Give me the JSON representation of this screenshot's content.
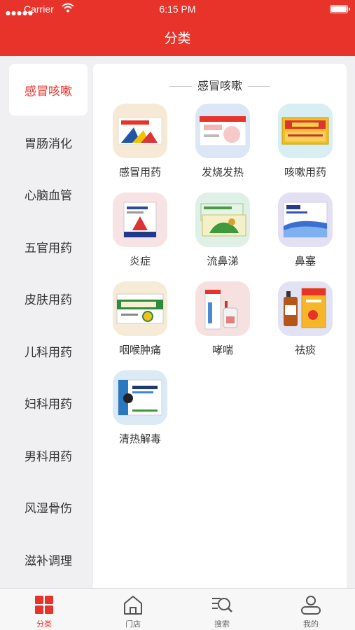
{
  "status_bar": {
    "carrier": "Carrier",
    "time": "6:15 PM"
  },
  "header": {
    "title": "分类"
  },
  "sidebar": {
    "items": [
      {
        "label": "感冒咳嗽",
        "active": true
      },
      {
        "label": "胃肠消化"
      },
      {
        "label": "心脑血管"
      },
      {
        "label": "五官用药"
      },
      {
        "label": "皮肤用药"
      },
      {
        "label": "儿科用药"
      },
      {
        "label": "妇科用药"
      },
      {
        "label": "男科用药"
      },
      {
        "label": "风湿骨伤"
      },
      {
        "label": "滋补调理"
      }
    ]
  },
  "main": {
    "section_title": "感冒咳嗽",
    "categories": [
      {
        "label": "感冒用药",
        "icon": "medicine-box-icon",
        "bg": "#f6ead7"
      },
      {
        "label": "发烧发热",
        "icon": "medicine-box-icon",
        "bg": "#dbe6f6"
      },
      {
        "label": "咳嗽用药",
        "icon": "medicine-box-icon",
        "bg": "#d8eef3"
      },
      {
        "label": "炎症",
        "icon": "medicine-box-icon",
        "bg": "#f7e3e3"
      },
      {
        "label": "流鼻涕",
        "icon": "medicine-box-icon",
        "bg": "#dff0e6"
      },
      {
        "label": "鼻塞",
        "icon": "medicine-box-icon",
        "bg": "#e3e0f3"
      },
      {
        "label": "咽喉肿痛",
        "icon": "medicine-box-icon",
        "bg": "#f6ebd6"
      },
      {
        "label": "哮喘",
        "icon": "medicine-box-icon",
        "bg": "#f7e0e0"
      },
      {
        "label": "祛痰",
        "icon": "medicine-box-icon",
        "bg": "#e1e3f4"
      },
      {
        "label": "清热解毒",
        "icon": "medicine-box-icon",
        "bg": "#dceaf6"
      }
    ]
  },
  "tabbar": {
    "tabs": [
      {
        "label": "分类",
        "icon": "category-grid-icon",
        "active": true
      },
      {
        "label": "门店",
        "icon": "store-icon"
      },
      {
        "label": "搜索",
        "icon": "search-icon"
      },
      {
        "label": "我的",
        "icon": "user-icon"
      }
    ]
  },
  "colors": {
    "accent": "#e8332a",
    "background": "#f0f0f3",
    "panel": "#ffffff"
  }
}
